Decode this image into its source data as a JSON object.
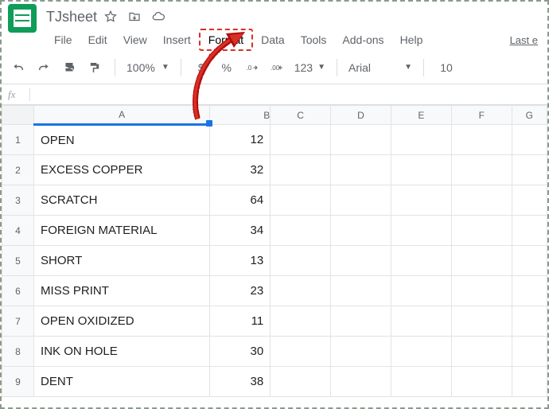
{
  "doc": {
    "name": "TJsheet"
  },
  "menu": {
    "items": [
      "File",
      "Edit",
      "View",
      "Insert",
      "Format",
      "Data",
      "Tools",
      "Add-ons",
      "Help"
    ],
    "highlight_index": 4,
    "last_edit": "Last e"
  },
  "toolbar": {
    "zoom": "100%",
    "number_format": "123",
    "font": "Arial",
    "font_size": "10",
    "currency": "$",
    "percent": "%"
  },
  "formula": {
    "fx": "fx",
    "value": ""
  },
  "grid": {
    "columns": [
      "A",
      "B",
      "C",
      "D",
      "E",
      "F",
      "G"
    ],
    "rows": [
      {
        "n": "1",
        "a": "OPEN",
        "b": "12"
      },
      {
        "n": "2",
        "a": "EXCESS COPPER",
        "b": "32"
      },
      {
        "n": "3",
        "a": "SCRATCH",
        "b": "64"
      },
      {
        "n": "4",
        "a": "FOREIGN MATERIAL",
        "b": "34"
      },
      {
        "n": "5",
        "a": "SHORT",
        "b": "13"
      },
      {
        "n": "6",
        "a": "MISS PRINT",
        "b": "23"
      },
      {
        "n": "7",
        "a": "OPEN OXIDIZED",
        "b": "11"
      },
      {
        "n": "8",
        "a": "INK ON HOLE",
        "b": "30"
      },
      {
        "n": "9",
        "a": "DENT",
        "b": "38"
      }
    ]
  }
}
